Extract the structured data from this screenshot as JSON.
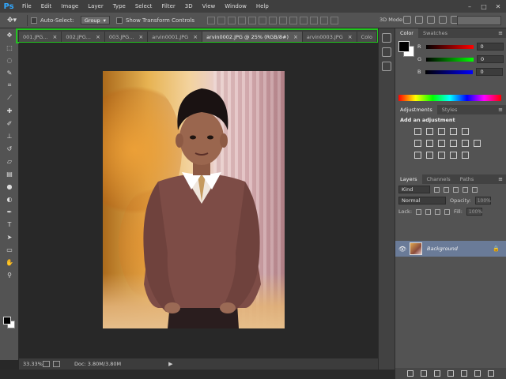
{
  "app": {
    "logo": "Ps"
  },
  "menu": [
    "File",
    "Edit",
    "Image",
    "Layer",
    "Type",
    "Select",
    "Filter",
    "3D",
    "View",
    "Window",
    "Help"
  ],
  "window_controls": {
    "minimize": "–",
    "maximize": "□",
    "close": "✕"
  },
  "options": {
    "auto_select_label": "Auto-Select:",
    "auto_select_value": "Group",
    "transform_label": "Show Transform Controls",
    "mode_label": "3D Mode:"
  },
  "tabs": [
    {
      "label": "001.JPG...",
      "active": false
    },
    {
      "label": "002.JPG...",
      "active": false
    },
    {
      "label": "003.JPG...",
      "active": false
    },
    {
      "label": "arvin0001.JPG",
      "active": false
    },
    {
      "label": "arvin0002.JPG @ 25% (RGB/8#)",
      "active": true
    },
    {
      "label": "arvin0003.JPG",
      "active": false
    },
    {
      "label": "Colo",
      "active": false
    }
  ],
  "tab_close": "×",
  "tab_more": "»",
  "status": {
    "zoom": "33.33%",
    "doc": "Doc: 3.80M/3.80M",
    "arrow": "▶"
  },
  "color_panel": {
    "tabs": [
      "Color",
      "Swatches"
    ],
    "channels": [
      {
        "label": "R",
        "value": "0",
        "gradient": "linear-gradient(90deg,#000,#f00)"
      },
      {
        "label": "G",
        "value": "0",
        "gradient": "linear-gradient(90deg,#000,#0f0)"
      },
      {
        "label": "B",
        "value": "0",
        "gradient": "linear-gradient(90deg,#000,#00f)"
      }
    ]
  },
  "adjustments_panel": {
    "tabs": [
      "Adjustments",
      "Styles"
    ],
    "title": "Add an adjustment"
  },
  "layers_panel": {
    "tabs": [
      "Layers",
      "Channels",
      "Paths"
    ],
    "kind": "Kind",
    "blend_mode": "Normal",
    "opacity_label": "Opacity:",
    "opacity_value": "100%",
    "lock_label": "Lock:",
    "fill_label": "Fill:",
    "fill_value": "100%",
    "layer": {
      "name": "Background"
    }
  },
  "panel_menu_glyph": "≡",
  "icons": {
    "eye": "👁",
    "lock": "🔒"
  },
  "colors": {
    "highlight": "#22c51f",
    "selected_layer": "#6a7b98",
    "ps_blue": "#31a8ff"
  }
}
